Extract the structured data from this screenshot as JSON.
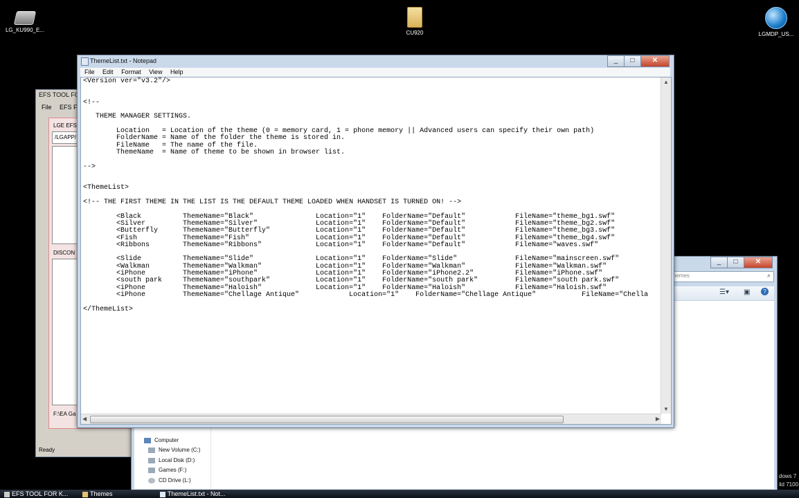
{
  "desktop": {
    "icons": [
      {
        "label": "LG_KU990_E...",
        "icon": "drive-icon"
      },
      {
        "label": "CU920",
        "icon": "folder-icon"
      },
      {
        "label": "LGMDP_US...",
        "icon": "att-globe-icon"
      }
    ],
    "watermark_line1": "dows 7",
    "watermark_line2": "ild 7100"
  },
  "notepad": {
    "title": "ThemeList.txt - Notepad",
    "menu": [
      "File",
      "Edit",
      "Format",
      "View",
      "Help"
    ],
    "content": "<Version ver=\"v3.2\"/>\n\n\n<!--\n\n   THEME MANAGER SETTINGS.\n\n        Location   = Location of the theme (0 = memory card, 1 = phone memory || Advanced users can specify their own path)\n        FolderName = Name of the folder the theme is stored in.\n        FileName   = The name of the file.\n        ThemeName  = Name of theme to be shown in browser list.\n\n-->\n\n\n<ThemeList>\n\n<!-- THE FIRST THEME IN THE LIST IS THE DEFAULT THEME LOADED WHEN HANDSET IS TURNED ON! -->\n\n        <Black          ThemeName=\"Black\"               Location=\"1\"    FolderName=\"Default\"            FileName=\"theme_bg1.swf\"\n        <Silver         ThemeName=\"Silver\"              Location=\"1\"    FolderName=\"Default\"            FileName=\"theme_bg2.swf\"\n        <Butterfly      ThemeName=\"Butterfly\"           Location=\"1\"    FolderName=\"Default\"            FileName=\"theme_bg3.swf\"\n        <Fish           ThemeName=\"Fish\"                Location=\"1\"    FolderName=\"Default\"            FileName=\"theme_bg4.swf\"\n        <Ribbons        ThemeName=\"Ribbons\"             Location=\"1\"    FolderName=\"Default\"            FileName=\"waves.swf\"\n\n        <Slide          ThemeName=\"Slide\"               Location=\"1\"    FolderName=\"Slide\"              FileName=\"mainscreen.swf\"\n        <Walkman        ThemeName=\"Walkman\"             Location=\"1\"    FolderName=\"Walkman\"            FileName=\"Walkman.swf\"\n        <iPhone         ThemeName=\"iPhone\"              Location=\"1\"    FolderName=\"iPhone2.2\"          FileName=\"iPhone.swf\"\n        <south park     ThemeName=\"southpark\"           Location=\"1\"    FolderName=\"south park\"         FileName=\"south park.swf\"\n        <iPhone         ThemeName=\"Haloish\"             Location=\"1\"    FolderName=\"Haloish\"            FileName=\"Haloish.swf\"\n        <iPhone         ThemeName=\"Chellage Antique\"            Location=\"1\"    FolderName=\"Chellage Antique\"           FileName=\"Chella\n\n</ThemeList>"
  },
  "explorer": {
    "search_placeholder": "Themes",
    "tree": [
      "Computer",
      "New Volume (C:)",
      "Local Disk (D:)",
      "Games (F:)",
      "CD Drive (L:)"
    ]
  },
  "efs_tool": {
    "title": "EFS TOOL FO",
    "menu": [
      "File",
      "EFS File"
    ],
    "panel_title": "LGE EFS B",
    "path": "/LGAPP/",
    "disconnect": "DISCON",
    "bottom_path": "F:\\EA Ga",
    "status": "Ready"
  },
  "taskbar": {
    "tasks": [
      "EFS TOOL FOR K...",
      "Themes",
      "ThemeList.txt - Not..."
    ]
  },
  "colors": {
    "desktop": "#000000",
    "window_frame": "#c9d9ea",
    "close_button": "#c5432a"
  }
}
